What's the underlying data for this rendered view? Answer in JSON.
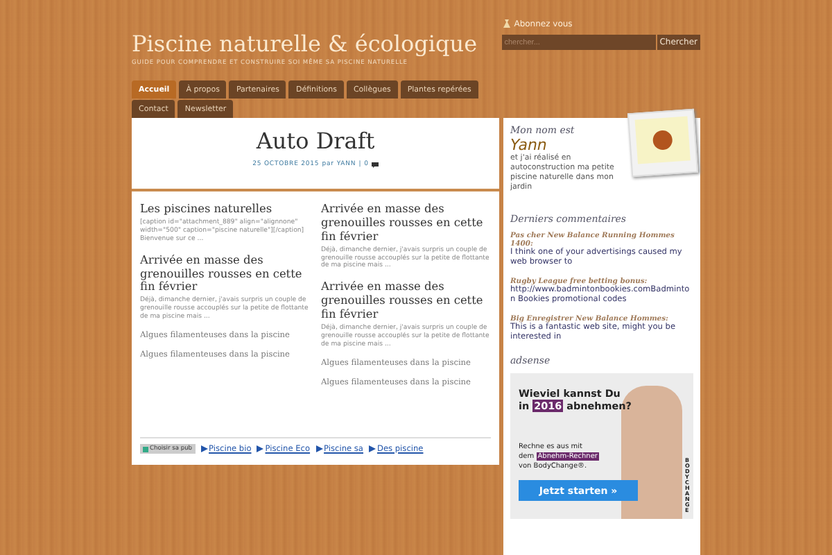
{
  "header": {
    "title": "Piscine naturelle & écologique",
    "tagline": "GUIDE POUR COMPRENDRE ET CONSTRUIRE SOI MÊME SA PISCINE NATURELLE"
  },
  "subscribe": "Abonnez vous",
  "search": {
    "placeholder": "chercher...",
    "button": "Chercher"
  },
  "tabs": [
    {
      "label": "Accueil",
      "selected": true
    },
    {
      "label": "À propos",
      "selected": false
    },
    {
      "label": "Partenaires",
      "selected": false
    },
    {
      "label": "Définitions",
      "selected": false
    },
    {
      "label": "Collègues",
      "selected": false
    },
    {
      "label": "Plantes repérées",
      "selected": false
    },
    {
      "label": "Contact",
      "selected": false
    },
    {
      "label": "Newsletter",
      "selected": false
    }
  ],
  "post": {
    "title": "Auto Draft",
    "date": "25 OCTOBRE 2015",
    "by": "par",
    "author": "YANN",
    "separator": "|",
    "comments": "0"
  },
  "columns": [
    [
      {
        "title": "Les piscines naturelles",
        "excerpt": "[caption id=\"attachment_889\" align=\"alignnone\" width=\"500\" caption=\"piscine naturelle\"][/caption] Bienvenue sur ce ..."
      },
      {
        "title": "Arrivée en masse des grenouilles rousses en cette fin février",
        "excerpt": "Déjà, dimanche dernier, j'avais surpris un couple de grenouille rousse accouplés sur la petite de flottante de ma piscine mais ..."
      },
      {
        "title": "Algues filamenteuses dans la piscine"
      },
      {
        "title": "Algues filamenteuses dans la piscine"
      }
    ],
    [
      {
        "title": "Arrivée en masse des grenouilles rousses en cette fin février",
        "excerpt": "Déjà, dimanche dernier, j'avais surpris un couple de grenouille rousse accouplés sur la petite de flottante de ma piscine mais ..."
      },
      {
        "title": "Arrivée en masse des grenouilles rousses en cette fin février",
        "excerpt": "Déjà, dimanche dernier, j'avais surpris un couple de grenouille rousse accouplés sur la petite de flottante de ma piscine mais ..."
      },
      {
        "title": "Algues filamenteuses dans la piscine"
      },
      {
        "title": "Algues filamenteuses dans la piscine"
      }
    ]
  ],
  "ad_choice": "Choisir sa pub",
  "ad_links": [
    "Piscine bio",
    "Piscine Eco",
    "Piscine sa",
    "Des piscine"
  ],
  "about": {
    "heading": "Mon nom est",
    "name": "Yann",
    "text": "et j'ai réalisé en autoconstruction ma petite piscine naturelle dans mon jardin"
  },
  "comments": {
    "heading": "Derniers commentaires",
    "items": [
      {
        "author": "Pas cher New Balance Running Hommes 1400:",
        "text": "I think one of your advertisings caused my web browser to"
      },
      {
        "author": "Rugby League free betting bonus:",
        "text": "http://www.badmintonbookies.comBadminton Bookies promotional codes"
      },
      {
        "author": "Big Enregistrer New Balance Hommes:",
        "text": "This is a fantastic web site, might you be interested in"
      }
    ]
  },
  "adsense": {
    "heading": "adsense",
    "headline_1": "Wieviel kannst Du",
    "headline_pre": "in",
    "headline_year": "2016",
    "headline_post": "abnehmen?",
    "body_1": "Rechne es aus mit",
    "body_pre": "dem",
    "body_tag": "Abnehm-Rechner",
    "body_2": "von BodyChange®.",
    "button": "Jetzt starten »",
    "brand": "BODYCHANGE"
  }
}
